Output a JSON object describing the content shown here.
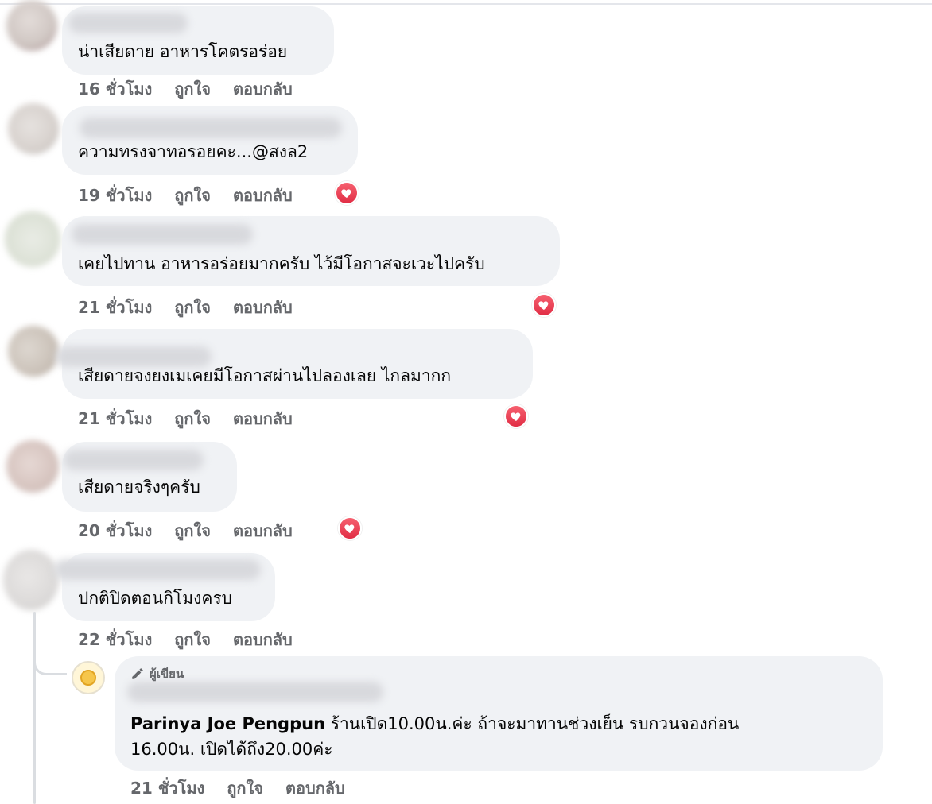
{
  "comments": [
    {
      "text": "น่าเสียดาย อาหารโคตรอร่อย",
      "time": "16 ชั่วโมง",
      "like": "ถูกใจ",
      "reply": "ตอบกลับ",
      "has_heart": false
    },
    {
      "text": "ความทรงจาทอรอยคะ...@สงล2",
      "time": "19 ชั่วโมง",
      "like": "ถูกใจ",
      "reply": "ตอบกลับ",
      "has_heart": true
    },
    {
      "text": "เคยไปทาน อาหารอร่อยมากครับ ไว้มีโอกาสจะเวะไปครับ",
      "time": "21 ชั่วโมง",
      "like": "ถูกใจ",
      "reply": "ตอบกลับ",
      "has_heart": true
    },
    {
      "text": "เสียดายจงยงเมเคยมีโอกาสผ่านไปลองเลย ไกลมากก",
      "time": "21 ชั่วโมง",
      "like": "ถูกใจ",
      "reply": "ตอบกลับ",
      "has_heart": true
    },
    {
      "text": "เสียดายจริงๆครับ",
      "time": "20 ชั่วโมง",
      "like": "ถูกใจ",
      "reply": "ตอบกลับ",
      "has_heart": true
    },
    {
      "text": "ปกติปิดตอนกิโมงครบ",
      "time": "22 ชั่วโมง",
      "like": "ถูกใจ",
      "reply": "ตอบกลับ",
      "has_heart": false
    }
  ],
  "reply": {
    "badge": "ผู้เขียน",
    "mention": "Parinya Joe Pengpun",
    "line1": " ร้านเปิด10.00น.ค่ะ ถ้าจะมาทานช่วงเย็น รบกวนจองก่อน",
    "line2": "16.00น. เปิดได้ถึง20.00ค่ะ",
    "time": "21 ชั่วโมง",
    "like": "ถูกใจ",
    "reply": "ตอบกลับ"
  },
  "colors": {
    "bubble": "#f0f2f5",
    "meta_text": "#65676b",
    "heart": "#e12d45"
  },
  "icons": {
    "reaction": "heart-icon",
    "author_badge": "pencil-icon"
  }
}
